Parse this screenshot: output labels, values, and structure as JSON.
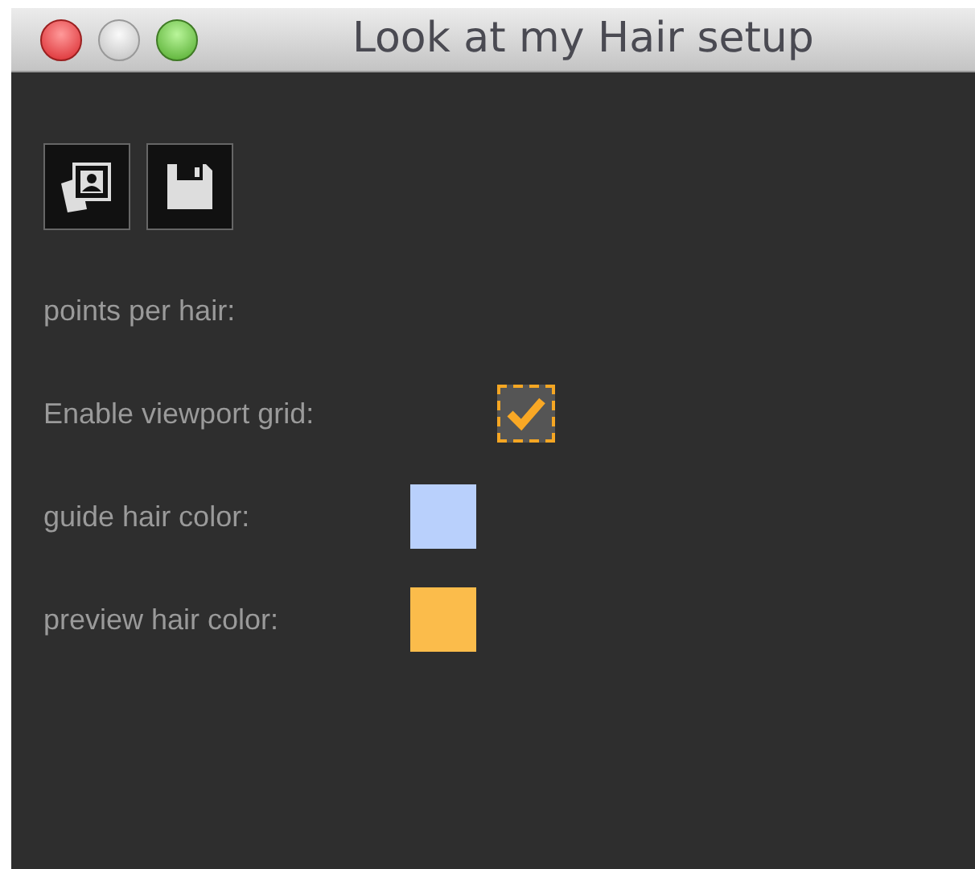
{
  "window": {
    "title": "Look at my Hair setup"
  },
  "toolbar": [
    {
      "kind": "photos"
    },
    {
      "kind": "save"
    }
  ],
  "rows": [
    {
      "kind": "label",
      "label": "points per hair:"
    },
    {
      "kind": "checkbox",
      "label": "Enable viewport grid:",
      "checked": true
    },
    {
      "kind": "color",
      "label": "guide hair color:",
      "color": "#b9d0fc"
    },
    {
      "kind": "color",
      "label": "preview hair color:",
      "color": "#fbbc4b"
    }
  ]
}
